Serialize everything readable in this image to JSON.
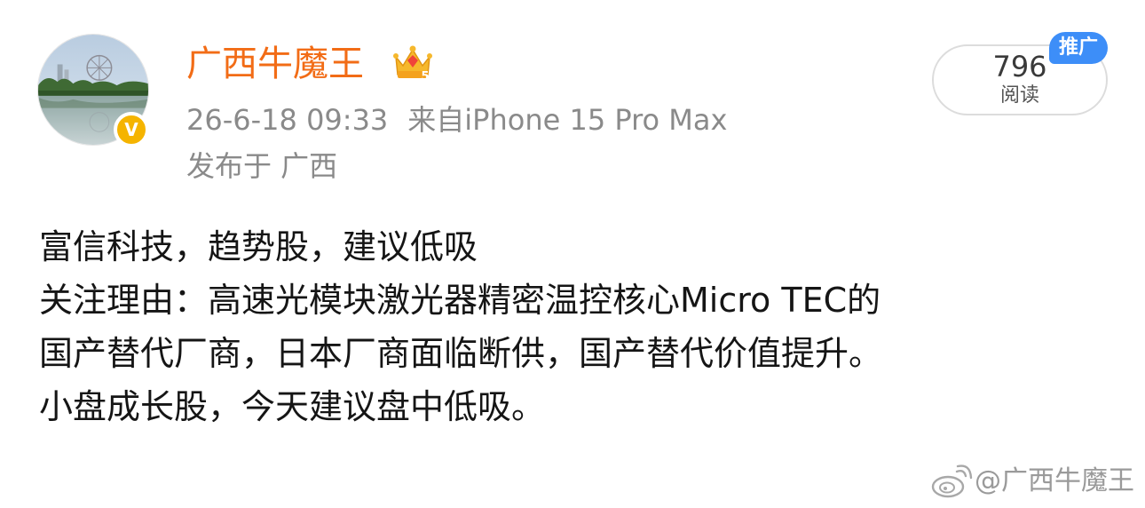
{
  "post": {
    "author": {
      "name": "广西牛魔王",
      "avatar_icon": "avatar-photo-lakeside-ferris-wheel",
      "verified_icon": "verified-v-badge-icon",
      "crown_icon": "member-crown-level-icon",
      "crown_level": "5"
    },
    "meta": {
      "timestamp": "26-6-18 09:33",
      "source": "来自iPhone 15 Pro Max",
      "location": "发布于 广西"
    },
    "reads": {
      "count": "796",
      "label": "阅读",
      "promo_tag": "推广"
    },
    "body": {
      "lines": [
        "富信科技，趋势股，建议低吸",
        "关注理由：高速光模块激光器精密温控核心Micro TEC的",
        "国产替代厂商，日本厂商面临断供，国产替代价值提升。",
        "小盘成长股，今天建议盘中低吸。"
      ]
    },
    "watermark": {
      "text": "@广西牛魔王",
      "icon": "weibo-logo-icon"
    }
  },
  "colors": {
    "username": "#f26c16",
    "meta_text": "#8a8a8a",
    "body_text": "#151515",
    "promo_tag_bg": "#3d8ef8",
    "verified_badge": "#f5b400",
    "watermark_text": "#9a9a9a"
  }
}
